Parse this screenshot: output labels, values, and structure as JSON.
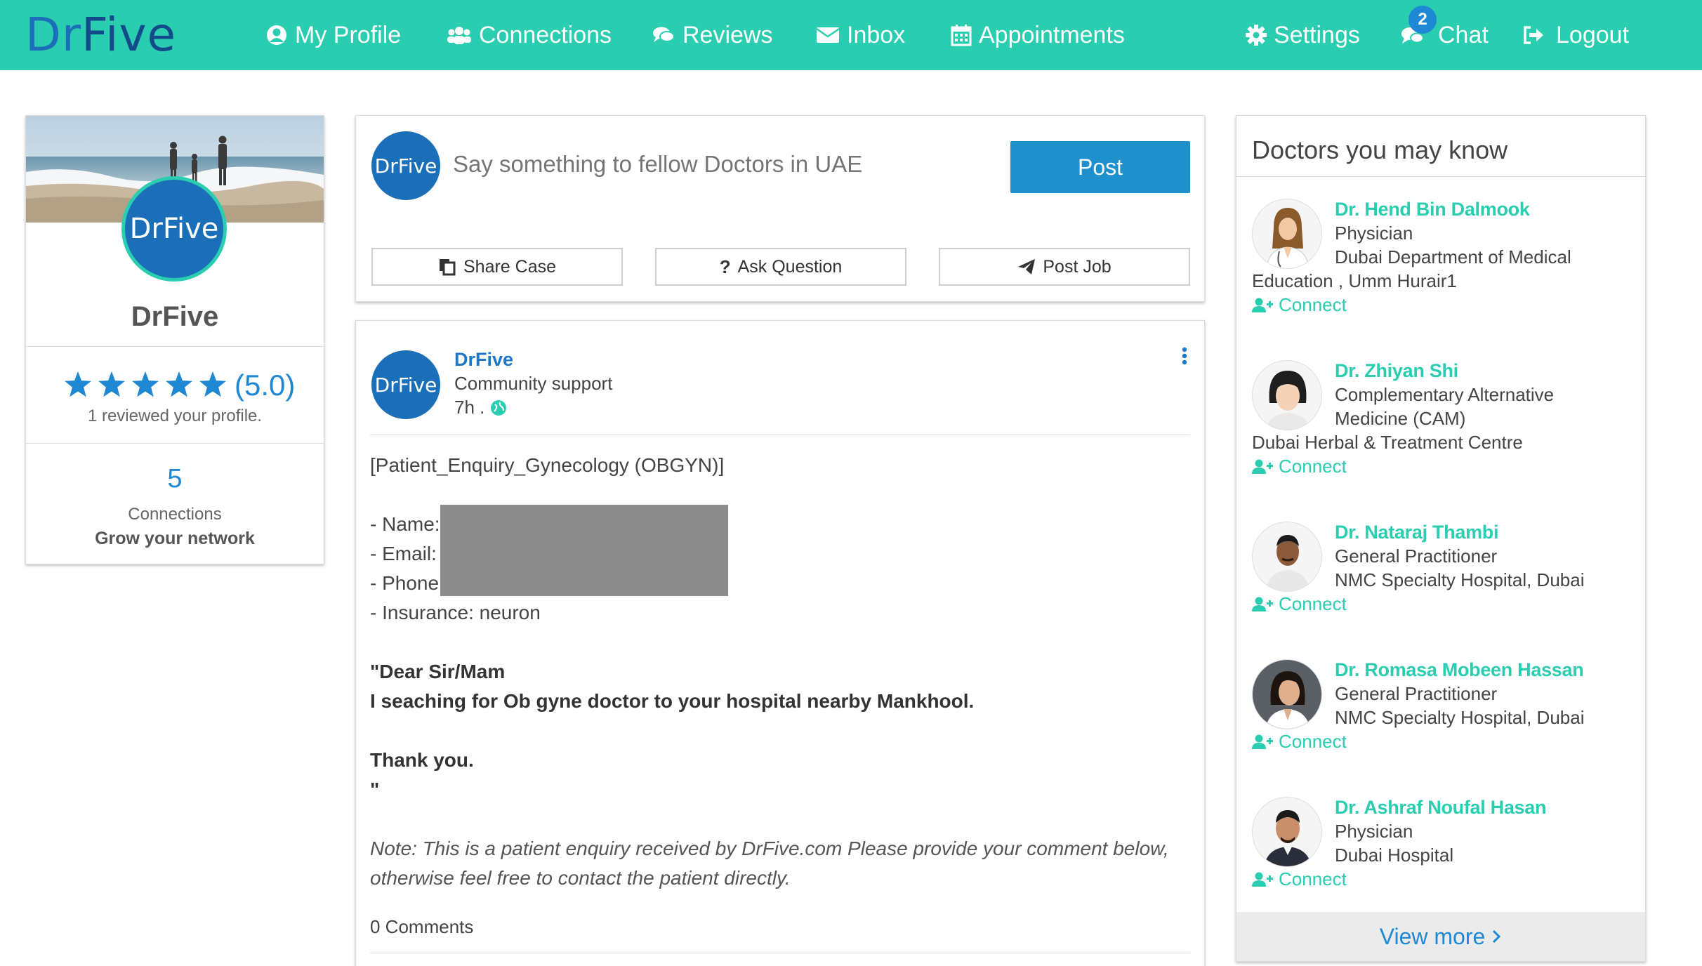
{
  "navbar": {
    "logo_dr": "Dr",
    "logo_five": "Five",
    "items": [
      {
        "label": "My Profile",
        "icon": "user-circle-icon"
      },
      {
        "label": "Connections",
        "icon": "users-icon"
      },
      {
        "label": "Reviews",
        "icon": "comments-icon"
      },
      {
        "label": "Inbox",
        "icon": "envelope-icon"
      },
      {
        "label": "Appointments",
        "icon": "calendar-icon"
      },
      {
        "label": "Settings",
        "icon": "gear-icon"
      },
      {
        "label": "Chat",
        "icon": "chat-icon"
      },
      {
        "label": "Logout",
        "icon": "logout-icon"
      }
    ],
    "chat_badge": "2"
  },
  "profile": {
    "avatar_text": "DrFive",
    "name": "DrFive",
    "stars": 5,
    "rating": "(5.0)",
    "reviewed_text": "1 reviewed your profile.",
    "connections_count": "5",
    "connections_label": "Connections",
    "grow_label": "Grow your network"
  },
  "composer": {
    "avatar_text": "DrFive",
    "placeholder": "Say something to fellow Doctors in UAE",
    "post_label": "Post",
    "share_case": "Share Case",
    "ask_question": "Ask Question",
    "post_job": "Post Job"
  },
  "post": {
    "avatar_text": "DrFive",
    "author": "DrFive",
    "subtitle": "Community support",
    "time": "7h .",
    "subject": "[Patient_Enquiry_Gynecology (OBGYN)]",
    "name_label": "- Name:",
    "email_label": "- Email:",
    "phone_label": "- Phone:",
    "insurance": "- Insurance: neuron",
    "message_line1": "\"Dear Sir/Mam",
    "message_line2": "I seaching for Ob gyne doctor to your hospital nearby Mankhool.",
    "thanks": "Thank you.",
    "closing_quote": "\"",
    "note_line1": "Note: This is a patient enquiry received by DrFive.com Please provide your comment below,",
    "note_line2": "otherwise feel free to contact the patient directly.",
    "comments": "0 Comments"
  },
  "sidebar": {
    "title": "Doctors you may know",
    "connect_label": "Connect",
    "view_more": "View more",
    "doctors": [
      {
        "name": "Dr. Hend Bin Dalmook",
        "line1": "Physician",
        "line2": "Dubai Department of Medical",
        "line3": "Education , Umm Hurair1"
      },
      {
        "name": "Dr. Zhiyan Shi",
        "line1": "Complementary Alternative",
        "line2": "Medicine (CAM)",
        "line3": "Dubai Herbal & Treatment Centre"
      },
      {
        "name": "Dr. Nataraj Thambi",
        "line1": "General Practitioner",
        "line2": "NMC Specialty Hospital, Dubai"
      },
      {
        "name": "Dr. Romasa Mobeen Hassan",
        "line1": "General Practitioner",
        "line2": "NMC Specialty Hospital, Dubai"
      },
      {
        "name": "Dr. Ashraf Noufal Hasan",
        "line1": "Physician",
        "line2": "Dubai Hospital"
      }
    ]
  },
  "colors": {
    "navbar": "#2bcdb0",
    "primary": "#1e88d4",
    "brand_blue": "#1b6fb8",
    "teal_text": "#2bcdb0"
  }
}
